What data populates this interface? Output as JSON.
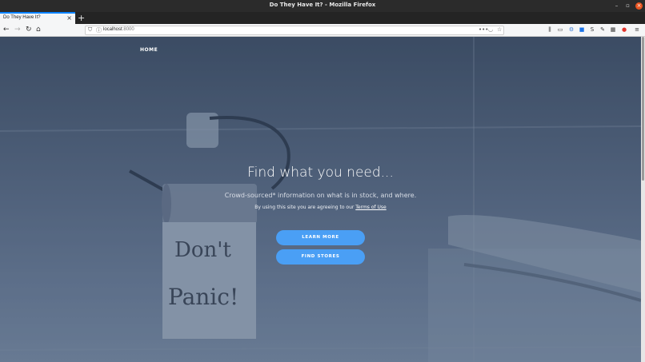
{
  "window": {
    "title": "Do They Have It? - Mozilla Firefox"
  },
  "tabs": [
    {
      "label": "Do They Have It?"
    }
  ],
  "addressbar": {
    "host": "localhost",
    "port": ":8000"
  },
  "page": {
    "nav": {
      "home": "HOME"
    },
    "hero": {
      "title": "Find what you need...",
      "subtitle": "Crowd-sourced* information on what is in stock, and where.",
      "terms_prefix": "By using this site you are agreeing to our ",
      "terms_link": "Terms of Use"
    },
    "buttons": {
      "learn_more": "LEARN MORE",
      "find_stores": "FIND STORES"
    },
    "background_note": {
      "line1": "Don't",
      "line2": "Panic!"
    }
  },
  "colors": {
    "accent": "#4a9ff5",
    "tab_accent": "#0a84ff",
    "hero_bg": "#5a6b85"
  },
  "icons": {
    "back": "arrow-left-icon",
    "forward": "arrow-right-icon",
    "reload": "reload-icon",
    "home": "home-icon",
    "info": "info-icon",
    "more": "more-icon",
    "pocket": "pocket-icon",
    "bookmark": "star-icon",
    "library": "library-icon",
    "sidebar": "sidebar-icon",
    "menu": "hamburger-menu-icon"
  }
}
